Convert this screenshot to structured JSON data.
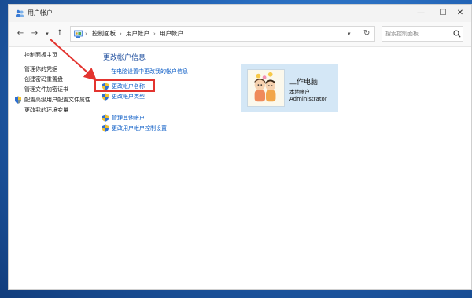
{
  "window": {
    "title": "用户帐户",
    "controls": {
      "minimize": "—",
      "maximize": "☐",
      "close": "✕"
    }
  },
  "nav": {
    "back": "←",
    "forward": "→",
    "dropdown": "▾",
    "up": "↑",
    "breadcrumbs": [
      "控制面板",
      "用户帐户",
      "用户帐户"
    ],
    "separator": "›",
    "address_dropdown": "▾",
    "refresh": "↻",
    "search_placeholder": "搜索控制面板"
  },
  "left_pane": {
    "home_link": "控制面板主页",
    "links": [
      "管理你的凭据",
      "创建密码重置盘",
      "管理文件加密证书",
      "配置高级用户配置文件属性",
      "更改我的环境变量"
    ]
  },
  "main": {
    "title": "更改帐户信息",
    "pc_settings_link": "在电脑设置中更改我的帐户信息",
    "tasks": [
      {
        "label": "更改帐户名称",
        "icon": "uac-shield-icon"
      },
      {
        "label": "更改帐户类型",
        "icon": "uac-shield-icon"
      },
      {
        "label": "管理其他帐户",
        "icon": "uac-shield-icon"
      },
      {
        "label": "更改用户帐户控制设置",
        "icon": "uac-shield-icon"
      }
    ],
    "highlighted_task": "更改帐户名称",
    "annotation_color": "#e3342f"
  },
  "user_card": {
    "name": "工作电脑",
    "type": "本地帐户",
    "role": "Administrator",
    "background": "#d4e7f6"
  },
  "colors": {
    "link": "#0b5cc6",
    "heading": "#1e4e9e",
    "desktop": "#2466b8"
  }
}
